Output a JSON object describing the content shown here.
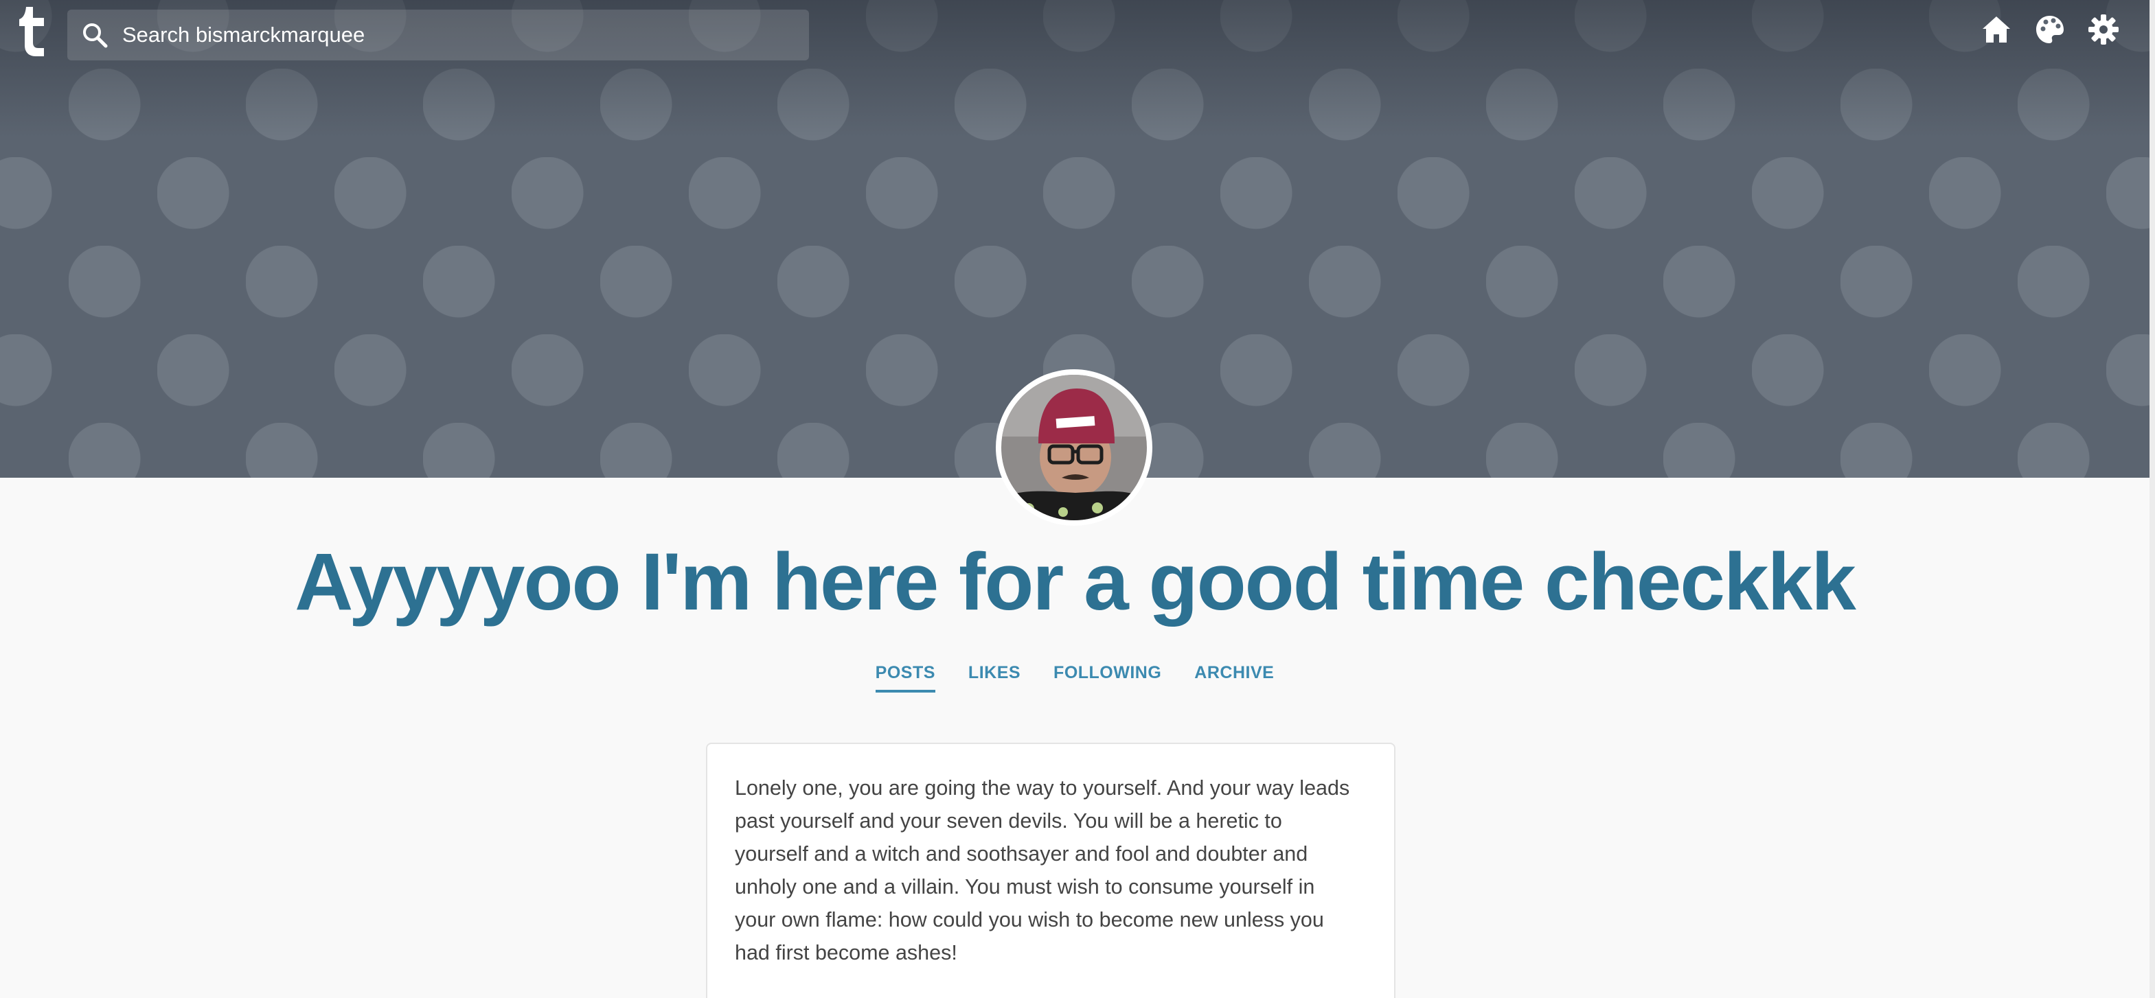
{
  "topbar": {
    "logo_icon": "tumblr-logo-icon",
    "search": {
      "icon": "search-icon",
      "placeholder": "Search bismarckmarquee"
    },
    "actions": [
      {
        "icon": "home-icon"
      },
      {
        "icon": "palette-icon"
      },
      {
        "icon": "gear-icon"
      }
    ]
  },
  "header": {
    "pattern": "polka-dots",
    "background_color": "#5b6470",
    "dot_color": "#6e7782"
  },
  "profile": {
    "avatar_icon": "avatar",
    "title": "Ayyyyoo I'm here for a good time checkkk"
  },
  "nav": {
    "tabs": [
      {
        "label": "POSTS",
        "active": true
      },
      {
        "label": "LIKES",
        "active": false
      },
      {
        "label": "FOLLOWING",
        "active": false
      },
      {
        "label": "ARCHIVE",
        "active": false
      }
    ]
  },
  "post": {
    "text": "Lonely one, you are going the way to yourself. And your way leads past yourself and your seven devils. You will be a heretic to yourself and a witch and soothsayer and fool and doubter and unholy one and a villain. You must wish to consume yourself in your own flame: how could you wish to become new unless you had first become ashes!"
  },
  "colors": {
    "accent": "#3c8ab0",
    "title": "#2d7192",
    "page_background": "#f9f9f9"
  }
}
